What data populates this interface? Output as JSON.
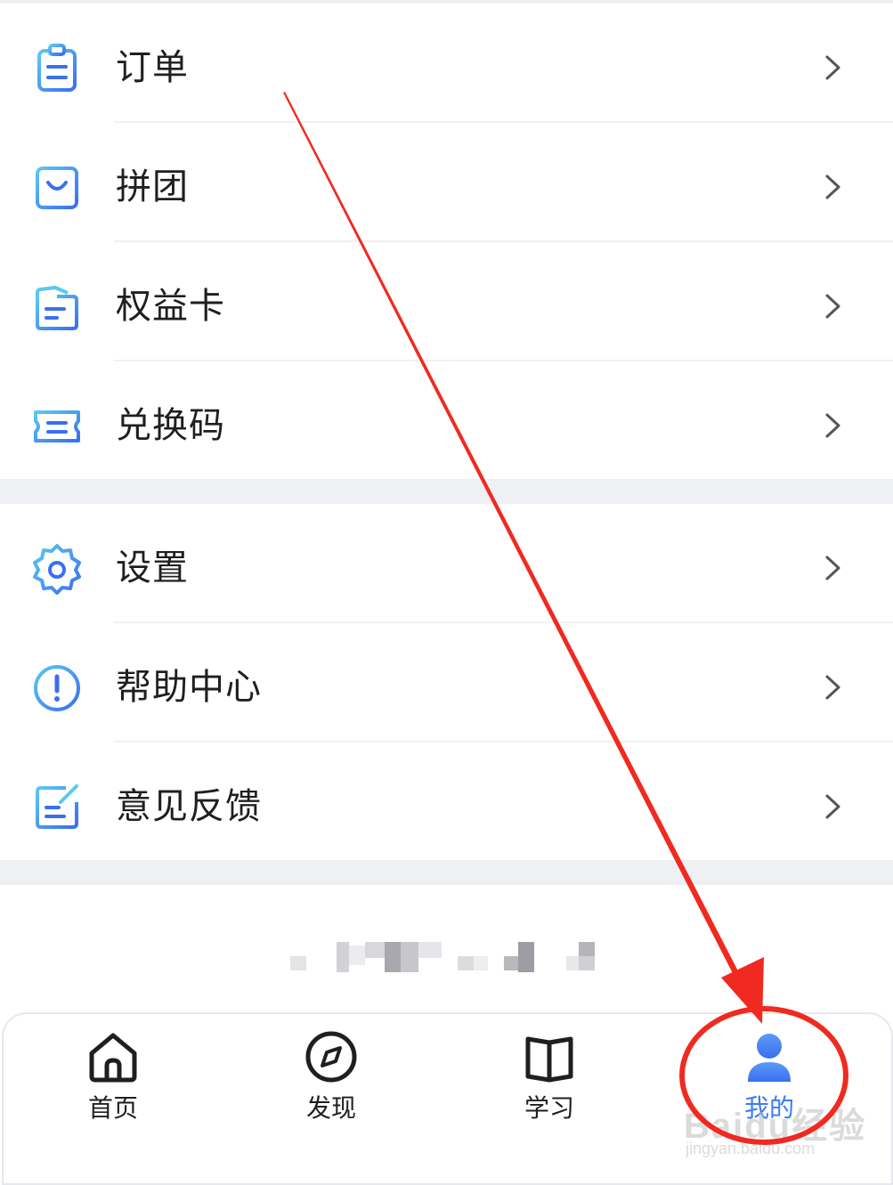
{
  "menu": {
    "group1": [
      {
        "label": "订单",
        "icon": "clipboard-icon"
      },
      {
        "label": "拼团",
        "icon": "shopping-bag-icon"
      },
      {
        "label": "权益卡",
        "icon": "card-folder-icon"
      },
      {
        "label": "兑换码",
        "icon": "ticket-icon"
      }
    ],
    "group2": [
      {
        "label": "设置",
        "icon": "gear-icon"
      },
      {
        "label": "帮助中心",
        "icon": "help-circle-icon"
      },
      {
        "label": "意见反馈",
        "icon": "feedback-edit-icon"
      }
    ]
  },
  "tabbar": {
    "tabs": [
      {
        "label": "首页",
        "icon": "home-icon"
      },
      {
        "label": "发现",
        "icon": "compass-icon"
      },
      {
        "label": "学习",
        "icon": "book-icon"
      },
      {
        "label": "我的",
        "icon": "user-icon",
        "active": true
      }
    ]
  },
  "watermark": {
    "main": "Baidu经验",
    "sub": "jingyan.baidu.com"
  },
  "colors": {
    "accent": "#3a7bf5",
    "icon_blue": "#4a86f0",
    "icon_cyan": "#5bc8f0",
    "annotation_red": "#f02a20",
    "section_gap": "#eef0f4"
  }
}
